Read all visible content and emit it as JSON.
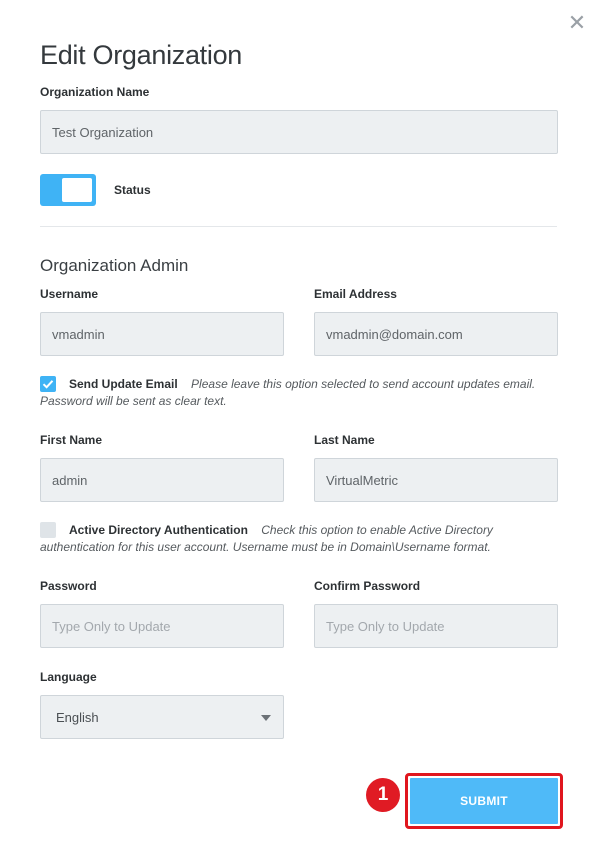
{
  "dialog": {
    "title": "Edit Organization",
    "close_icon": "close-icon",
    "accent_color": "#3fb3f5",
    "marker_color": "#e01b24"
  },
  "organization": {
    "name_label": "Organization Name",
    "name_value": "Test Organization",
    "status_label": "Status",
    "status_enabled": true
  },
  "admin": {
    "section_title": "Organization Admin",
    "username_label": "Username",
    "username_value": "vmadmin",
    "email_label": "Email Address",
    "email_value": "vmadmin@domain.com",
    "send_update": {
      "checked": true,
      "label": "Send Update Email",
      "hint": "Please leave this option selected to send account updates email. Password will be sent as clear text."
    },
    "first_name_label": "First Name",
    "first_name_value": "admin",
    "last_name_label": "Last Name",
    "last_name_value": "VirtualMetric",
    "ad_auth": {
      "checked": false,
      "label": "Active Directory Authentication",
      "hint": "Check this option to enable Active Directory authentication for this user account. Username must be in Domain\\Username format."
    },
    "password_label": "Password",
    "password_placeholder": "Type Only to Update",
    "confirm_password_label": "Confirm Password",
    "confirm_password_placeholder": "Type Only to Update",
    "language_label": "Language",
    "language_value": "English"
  },
  "actions": {
    "submit_label": "SUBMIT",
    "step_marker": "1"
  }
}
